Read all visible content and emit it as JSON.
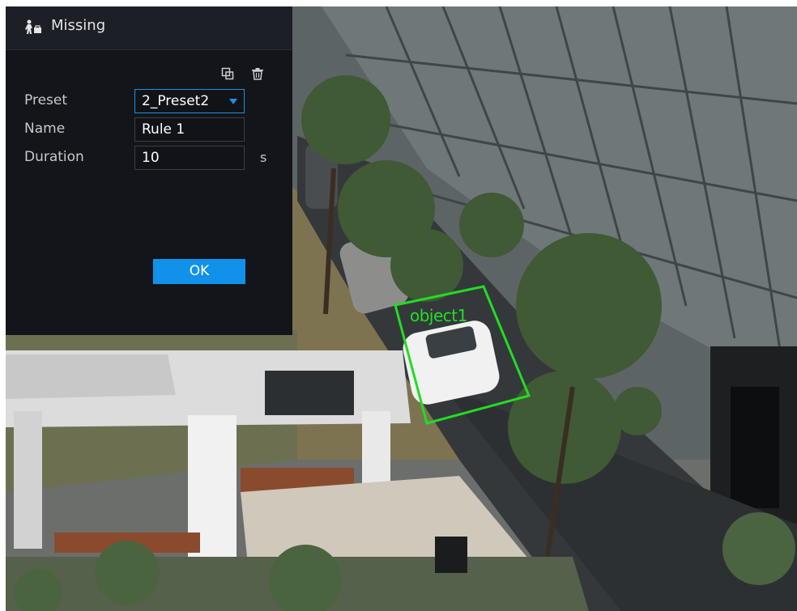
{
  "panel": {
    "title": "Missing",
    "header_icon": "person-with-object-icon",
    "toolbar": {
      "add_area_icon": "draw-area-icon",
      "delete_icon": "trash-icon"
    },
    "fields": {
      "preset_label": "Preset",
      "preset_value": "2_Preset2",
      "name_label": "Name",
      "name_value": "Rule 1",
      "duration_label": "Duration",
      "duration_value": "10",
      "duration_unit": "s"
    },
    "ok_label": "OK"
  },
  "overlay": {
    "object_label": "object1",
    "box_color": "#22dd22"
  },
  "colors": {
    "accent": "#1191ea",
    "panel_bg": "#13151a"
  }
}
